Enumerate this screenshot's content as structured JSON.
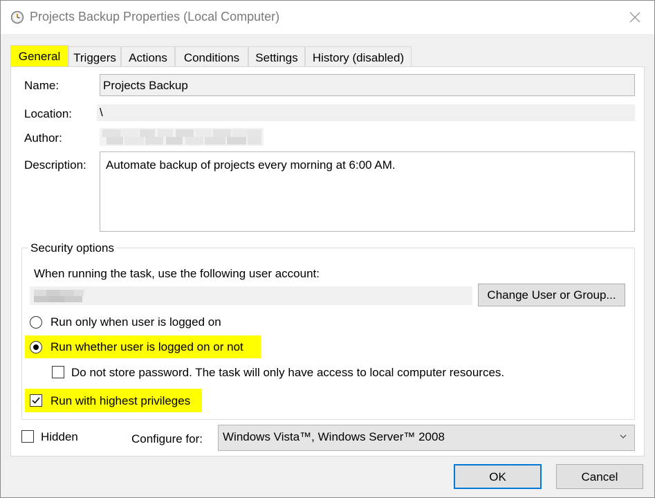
{
  "window": {
    "title": "Projects Backup Properties (Local Computer)",
    "icon": "task-scheduler-clock-icon"
  },
  "tabs": [
    {
      "label": "General",
      "active": true
    },
    {
      "label": "Triggers",
      "active": false
    },
    {
      "label": "Actions",
      "active": false
    },
    {
      "label": "Conditions",
      "active": false
    },
    {
      "label": "Settings",
      "active": false
    },
    {
      "label": "History (disabled)",
      "active": false
    }
  ],
  "general": {
    "name_label": "Name:",
    "name_value": "Projects Backup",
    "location_label": "Location:",
    "location_value": "\\",
    "author_label": "Author:",
    "description_label": "Description:",
    "description_value": "Automate backup of projects every morning at 6:00 AM."
  },
  "security": {
    "legend": "Security options",
    "account_prompt": "When running the task, use the following user account:",
    "change_user_button": "Change User or Group...",
    "radio_logged_on": "Run only when user is logged on",
    "radio_logged_on_checked": false,
    "radio_whether": "Run whether user is logged on or not",
    "radio_whether_checked": true,
    "do_not_store_password": "Do not store password.  The task will only have access to local computer resources.",
    "do_not_store_password_checked": false,
    "highest_privileges": "Run with highest privileges",
    "highest_privileges_checked": true
  },
  "bottom": {
    "hidden_label": "Hidden",
    "hidden_checked": false,
    "configure_label": "Configure for:",
    "configure_value": "Windows Vista™, Windows Server™ 2008"
  },
  "buttons": {
    "ok": "OK",
    "cancel": "Cancel"
  },
  "colors": {
    "highlight": "#ffff00",
    "focus_border": "#0078d7"
  }
}
